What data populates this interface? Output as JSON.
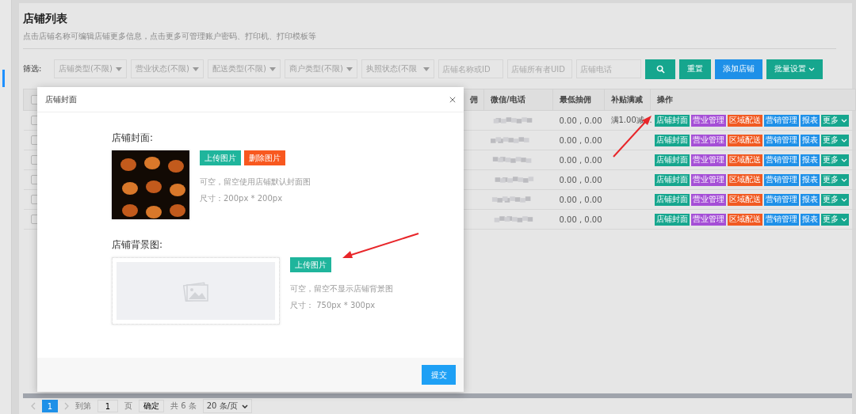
{
  "page": {
    "title": "店铺列表",
    "subtitle": "点击店铺名称可编辑店铺更多信息，点击更多可管理账户密码、打印机、打印模板等"
  },
  "filters": {
    "label": "筛选:",
    "selects": [
      "店铺类型(不限)",
      "营业状态(不限)",
      "配送类型(不限)",
      "商户类型(不限)",
      "执照状态(不限"
    ],
    "inputs": [
      {
        "placeholder": "店铺名称或ID"
      },
      {
        "placeholder": "店铺所有者UID"
      },
      {
        "placeholder": "店铺电话"
      }
    ],
    "buttons": [
      {
        "label": "重置",
        "color": "#16a68e",
        "caret": false
      },
      {
        "label": "添加店铺",
        "color": "#1e90e8",
        "caret": false
      },
      {
        "label": "批量设置",
        "color": "#16a68e",
        "caret": true
      }
    ]
  },
  "table": {
    "header_checkbox": {
      "checked": false
    },
    "columns": [
      "佣",
      "微信/电话",
      "最低抽佣",
      "补贴满减",
      "操作"
    ],
    "rows": [
      {
        "checked": false,
        "min_commission": "0.00 , 0.00",
        "subsidy": "满1.00减…",
        "actions": [
          {
            "label": "店铺封面",
            "color": "#16a68e",
            "caret": false
          },
          {
            "label": "营业管理",
            "color": "#a54fd6",
            "caret": false
          },
          {
            "label": "区域配送",
            "color": "#f15a22",
            "caret": false
          },
          {
            "label": "营销管理",
            "color": "#1e90e8",
            "caret": false
          },
          {
            "label": "报表",
            "color": "#1e90e8",
            "caret": false
          },
          {
            "label": "更多",
            "color": "#16a68e",
            "caret": true
          }
        ]
      },
      {
        "checked": false,
        "min_commission": "0.00 , 0.00",
        "actions": [
          {
            "label": "店铺封面",
            "color": "#16a68e",
            "caret": false
          },
          {
            "label": "营业管理",
            "color": "#a54fd6",
            "caret": false
          },
          {
            "label": "区域配送",
            "color": "#f15a22",
            "caret": false
          },
          {
            "label": "营销管理",
            "color": "#1e90e8",
            "caret": false
          },
          {
            "label": "报表",
            "color": "#1e90e8",
            "caret": false
          },
          {
            "label": "更多",
            "color": "#16a68e",
            "caret": true
          }
        ]
      },
      {
        "checked": false,
        "min_commission": "0.00 , 0.00",
        "actions": [
          {
            "label": "店铺封面",
            "color": "#16a68e",
            "caret": false
          },
          {
            "label": "营业管理",
            "color": "#a54fd6",
            "caret": false
          },
          {
            "label": "区域配送",
            "color": "#f15a22",
            "caret": false
          },
          {
            "label": "营销管理",
            "color": "#1e90e8",
            "caret": false
          },
          {
            "label": "报表",
            "color": "#1e90e8",
            "caret": false
          },
          {
            "label": "更多",
            "color": "#16a68e",
            "caret": true
          }
        ]
      },
      {
        "checked": false,
        "min_commission": "0.00 , 0.00",
        "actions": [
          {
            "label": "店铺封面",
            "color": "#16a68e",
            "caret": false
          },
          {
            "label": "营业管理",
            "color": "#a54fd6",
            "caret": false
          },
          {
            "label": "区域配送",
            "color": "#f15a22",
            "caret": false
          },
          {
            "label": "营销管理",
            "color": "#1e90e8",
            "caret": false
          },
          {
            "label": "报表",
            "color": "#1e90e8",
            "caret": false
          },
          {
            "label": "更多",
            "color": "#16a68e",
            "caret": true
          }
        ]
      },
      {
        "checked": false,
        "min_commission": "0.00 , 0.00",
        "actions": [
          {
            "label": "店铺封面",
            "color": "#16a68e",
            "caret": false
          },
          {
            "label": "营业管理",
            "color": "#a54fd6",
            "caret": false
          },
          {
            "label": "区域配送",
            "color": "#f15a22",
            "caret": false
          },
          {
            "label": "营销管理",
            "color": "#1e90e8",
            "caret": false
          },
          {
            "label": "报表",
            "color": "#1e90e8",
            "caret": false
          },
          {
            "label": "更多",
            "color": "#16a68e",
            "caret": true
          }
        ]
      },
      {
        "checked": false,
        "min_commission": "0.00 , 0.00",
        "actions": [
          {
            "label": "店铺封面",
            "color": "#16a68e",
            "caret": false
          },
          {
            "label": "营业管理",
            "color": "#a54fd6",
            "caret": false
          },
          {
            "label": "区域配送",
            "color": "#f15a22",
            "caret": false
          },
          {
            "label": "营销管理",
            "color": "#1e90e8",
            "caret": false
          },
          {
            "label": "报表",
            "color": "#1e90e8",
            "caret": false
          },
          {
            "label": "更多",
            "color": "#16a68e",
            "caret": true
          }
        ]
      }
    ]
  },
  "pagination": {
    "pages": [
      {
        "label": "1",
        "selected": true
      }
    ],
    "goto_label": "到第",
    "goto_value": "1",
    "page_unit": "页",
    "confirm": "确定",
    "total": "共 6 条",
    "page_size": "20 条/页"
  },
  "modal": {
    "title": "店铺封面",
    "cover": {
      "label": "店铺封面:",
      "buttons": [
        {
          "label": "上传图片",
          "color": "#1fb59c"
        },
        {
          "label": "删除图片",
          "color": "#f8581f"
        }
      ],
      "hints": [
        "可空，留空使用店铺默认封面图",
        "尺寸：200px * 200px"
      ]
    },
    "background": {
      "label": "店铺背景图:",
      "buttons": [
        {
          "label": "上传图片",
          "color": "#1fb59c"
        }
      ],
      "hints": [
        "可空，留空不显示店铺背景图",
        "尺寸： 750px * 300px"
      ]
    },
    "submit": "提交"
  }
}
